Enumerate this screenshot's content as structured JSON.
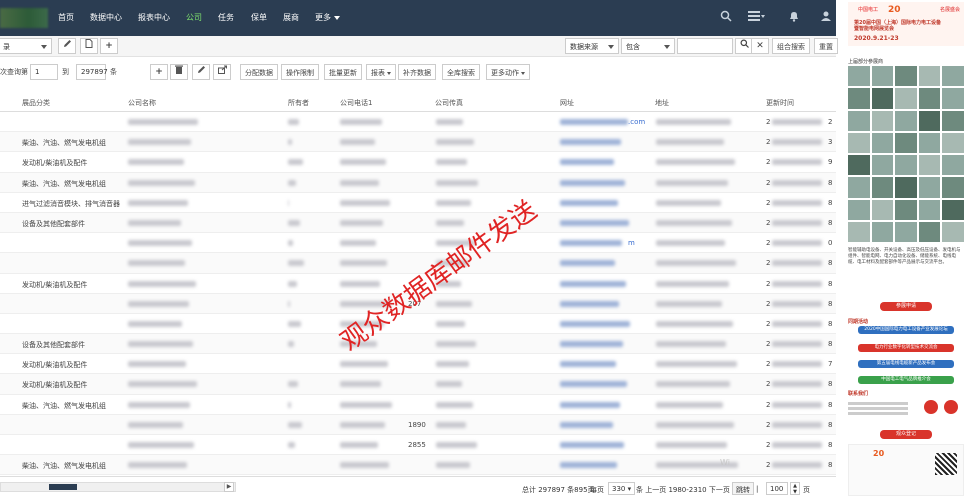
{
  "nav": {
    "items": [
      {
        "label": "首页",
        "active": false
      },
      {
        "label": "数据中心",
        "active": false
      },
      {
        "label": "报表中心",
        "active": false
      },
      {
        "label": "公司",
        "active": true
      },
      {
        "label": "任务",
        "active": false
      },
      {
        "label": "保单",
        "active": false
      },
      {
        "label": "展商",
        "active": false
      },
      {
        "label": "更多",
        "active": false
      }
    ]
  },
  "toolbar1": {
    "left_select": "录",
    "filter_field": "数据来源",
    "filter_op": "包含",
    "filter_value": "",
    "combo_search": "组合搜索",
    "reset": "重置"
  },
  "toolbar2": {
    "query_label": "次查询第",
    "from_value": "1",
    "to_label": "到",
    "to_value": "297897",
    "unit_label": "条",
    "actions": [
      "分配数据",
      "操作限制",
      "批量更新",
      "报表",
      "补齐数据",
      "全库搜索",
      "更多动作"
    ]
  },
  "table": {
    "columns": [
      "展品分类",
      "公司名称",
      "所有者",
      "公司电话1",
      "公司传真",
      "网址",
      "地址",
      "更新时间"
    ],
    "rows": [
      {
        "category": "",
        "fax": "",
        "url": ".com",
        "date": "2",
        "tail": "2"
      },
      {
        "category": "柴油、汽油、燃气发电机组",
        "fax": "",
        "url": "",
        "date": "2",
        "tail": "3"
      },
      {
        "category": "发动机/柴油机及配件",
        "fax": "",
        "url": "",
        "date": "2",
        "tail": "9"
      },
      {
        "category": "柴油、汽油、燃气发电机组",
        "fax": "",
        "url": "",
        "date": "2",
        "tail": "8"
      },
      {
        "category": "进气过滤消音模块、排气消音器",
        "fax": "",
        "url": "",
        "date": "2",
        "tail": "8"
      },
      {
        "category": "设备及其他配套部件",
        "fax": "",
        "url": "",
        "date": "2",
        "tail": "8"
      },
      {
        "category": "",
        "fax": "",
        "url": "m",
        "date": "2",
        "tail": "0"
      },
      {
        "category": "",
        "fax": "",
        "url": "",
        "date": "2",
        "tail": "8"
      },
      {
        "category": "发动机/柴油机及配件",
        "fax": "",
        "url": "",
        "date": "2",
        "tail": "8"
      },
      {
        "category": "",
        "fax": "207",
        "url": "",
        "date": "2",
        "tail": "8"
      },
      {
        "category": "",
        "fax": "",
        "url": "",
        "date": "2",
        "tail": "8"
      },
      {
        "category": "设备及其他配套部件",
        "fax": "",
        "url": "",
        "date": "2",
        "tail": "8"
      },
      {
        "category": "发动机/柴油机及配件",
        "fax": "",
        "url": "",
        "date": "2",
        "tail": "7"
      },
      {
        "category": "发动机/柴油机及配件",
        "fax": "",
        "url": "",
        "date": "2",
        "tail": "8"
      },
      {
        "category": "柴油、汽油、燃气发电机组",
        "fax": "",
        "url": "",
        "date": "2",
        "tail": "8"
      },
      {
        "category": "",
        "fax": "1890",
        "url": "",
        "date": "2",
        "tail": "8"
      },
      {
        "category": "",
        "fax": "2855",
        "url": "",
        "date": "2",
        "tail": "8"
      },
      {
        "category": "柴油、汽油、燃气发电机组",
        "fax": "",
        "url": "",
        "date": "2",
        "tail": "8"
      }
    ]
  },
  "watermark": "观众数据库邮件发送",
  "pagination": {
    "summary": "总计 297897 条895页",
    "per_page_label": "每页",
    "per_page": "330",
    "nav_text": "条 上一页  1980-2310  下一页",
    "jump": "跳转",
    "page_value": "100",
    "page_unit": "页"
  },
  "win_watermark": "Wi",
  "ad": {
    "brand": "中国电工",
    "number": "20",
    "tag": "名展盛会",
    "title": "第20届中国（上海）国际电力电工设备暨智能电网展览会",
    "date": "2020.9.21-23",
    "subtitle": "上届部分参展商",
    "paragraph": "智能辅助电设备、开关设备、高压及低压设备、发电机与组件、智能电网、电力自动化设备、储能系统、电线电缆、电工材料及配套部件等产品展示与交流平台。",
    "register": "参展申请",
    "section1": "同期活动",
    "links": [
      "2020中国国际电力电工设备产业发展论坛",
      "电力行业数字化转型技术交流会",
      "第五届电线电缆新产品发布会",
      "中国电工电气品牌推介会"
    ],
    "section2": "联系我们",
    "visit": "观众登记"
  }
}
